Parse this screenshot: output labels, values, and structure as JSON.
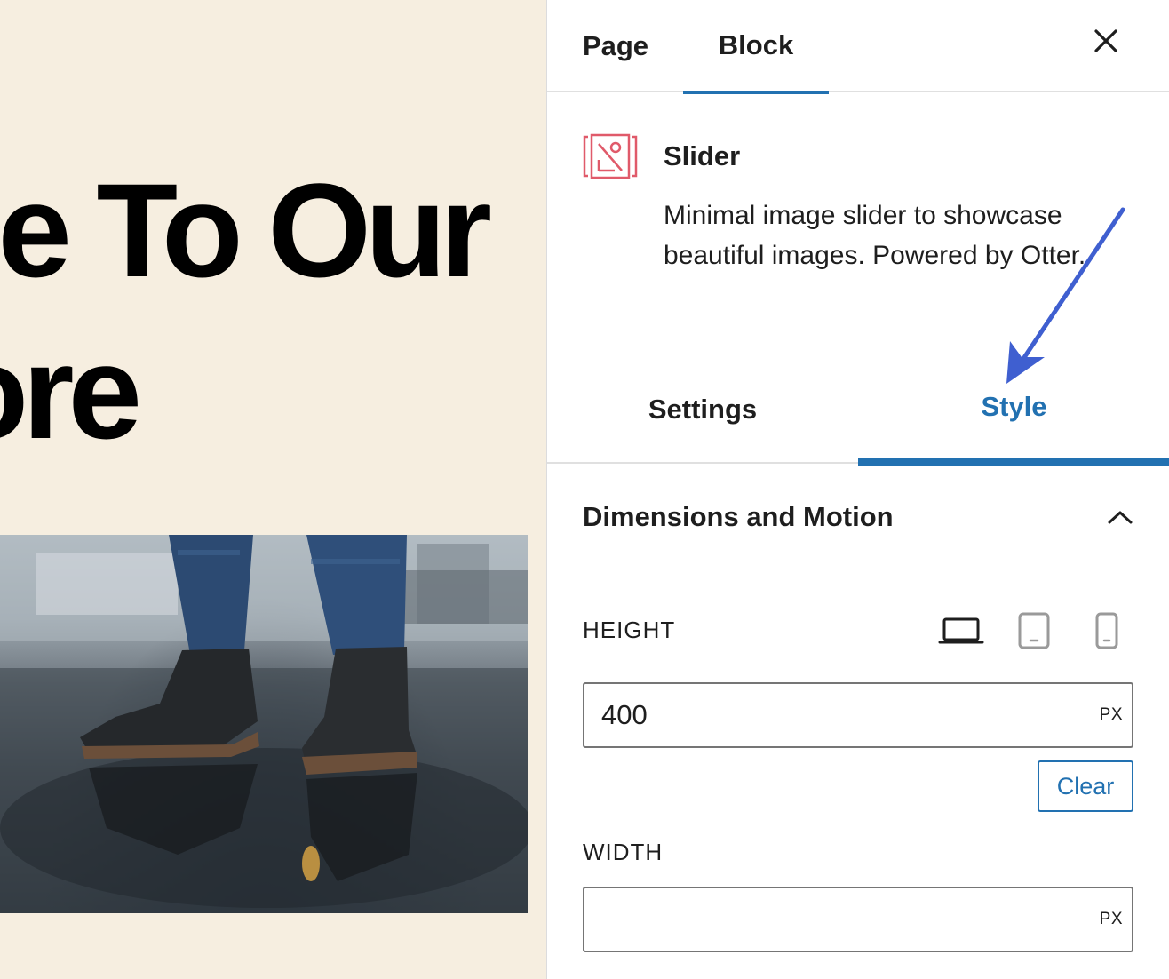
{
  "canvas": {
    "heading_line1": "e To Our",
    "heading_line2": "ore",
    "image_alt": "Boots standing in a puddle"
  },
  "sidebar": {
    "tabs": [
      {
        "label": "Page",
        "active": false
      },
      {
        "label": "Block",
        "active": true
      }
    ],
    "close_icon": "close-icon",
    "block": {
      "icon": "slider-image-icon",
      "title": "Slider",
      "description": "Minimal image slider to showcase beautiful images. Powered by Otter."
    },
    "inspector_tabs": [
      {
        "label": "Settings",
        "active": false
      },
      {
        "label": "Style",
        "active": true
      }
    ],
    "panel": {
      "title": "Dimensions and Motion",
      "expanded": true,
      "height": {
        "label": "HEIGHT",
        "value": "400",
        "unit": "PX",
        "clear_label": "Clear",
        "devices": [
          "desktop-icon",
          "tablet-icon",
          "mobile-icon"
        ],
        "active_device": "desktop-icon"
      },
      "width": {
        "label": "WIDTH",
        "value": "",
        "unit": "PX"
      }
    }
  },
  "colors": {
    "accent": "#2271b1",
    "canvas_background": "#f6eee0",
    "annotation_arrow": "#3f5fd0",
    "block_icon": "#e05a6a"
  }
}
